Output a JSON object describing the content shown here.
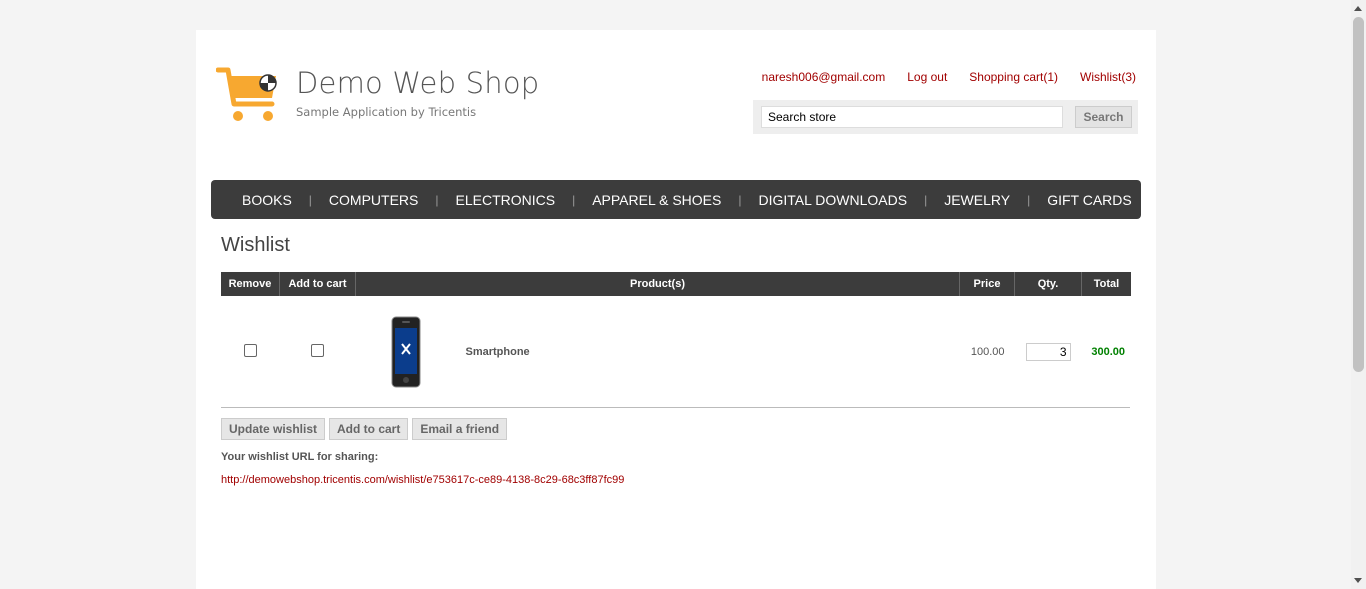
{
  "header": {
    "logo_title": "Demo Web Shop",
    "logo_subtitle": "Sample Application by Tricentis",
    "links": [
      "naresh006@gmail.com",
      "Log out",
      "Shopping cart(1)",
      "Wishlist(3)"
    ],
    "search": {
      "value": "Search store",
      "button_label": "Search"
    }
  },
  "menu": [
    "BOOKS",
    "COMPUTERS",
    "ELECTRONICS",
    "APPAREL & SHOES",
    "DIGITAL DOWNLOADS",
    "JEWELRY",
    "GIFT CARDS"
  ],
  "wishlist": {
    "title": "Wishlist",
    "columns": [
      "Remove",
      "Add to cart",
      "Product(s)",
      "Price",
      "Qty.",
      "Total"
    ],
    "rows": [
      {
        "product": "Smartphone",
        "price": "100.00",
        "qty": "3",
        "total": "300.00",
        "remove": false,
        "add_to_cart": false
      }
    ],
    "buttons": {
      "update": "Update wishlist",
      "add_to_cart": "Add to cart",
      "email": "Email a friend"
    },
    "share_label": "Your wishlist URL for sharing:",
    "share_url": "http://demowebshop.tricentis.com/wishlist/e753617c-ce89-4138-8c29-68c3ff87fc99"
  },
  "colors": {
    "accent_link": "#a10000",
    "menu_bg": "#3c3c3c",
    "total_green": "#008000",
    "logo_orange": "#f7a830"
  }
}
